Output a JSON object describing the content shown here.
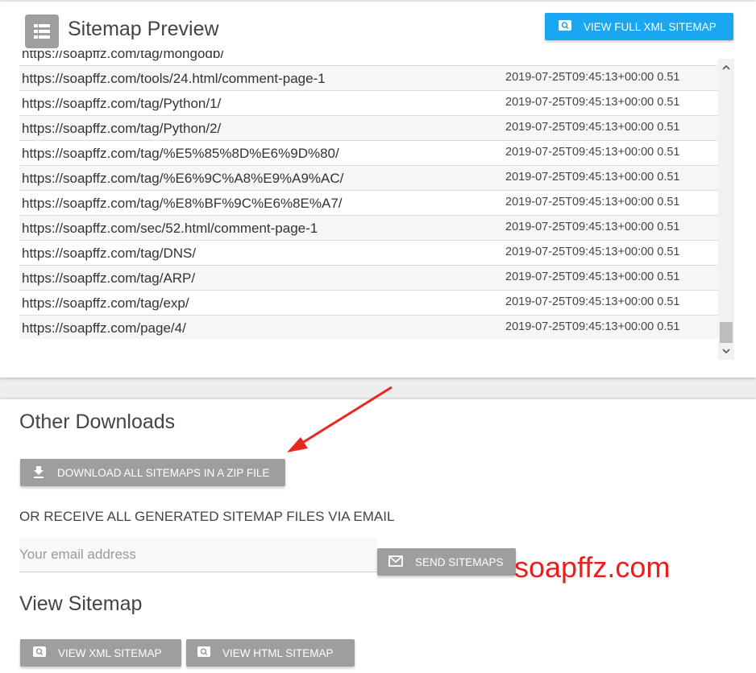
{
  "preview": {
    "title": "Sitemap Preview",
    "view_full_label": "VIEW FULL XML SITEMAP",
    "partial_row_url": "https://soapffz.com/tag/mongodb/",
    "rows": [
      {
        "url": "https://soapffz.com/tools/24.html/comment-page-1",
        "meta": "2019-07-25T09:45:13+00:00 0.51"
      },
      {
        "url": "https://soapffz.com/tag/Python/1/",
        "meta": "2019-07-25T09:45:13+00:00 0.51"
      },
      {
        "url": "https://soapffz.com/tag/Python/2/",
        "meta": "2019-07-25T09:45:13+00:00 0.51"
      },
      {
        "url": "https://soapffz.com/tag/%E5%85%8D%E6%9D%80/",
        "meta": "2019-07-25T09:45:13+00:00 0.51"
      },
      {
        "url": "https://soapffz.com/tag/%E6%9C%A8%E9%A9%AC/",
        "meta": "2019-07-25T09:45:13+00:00 0.51"
      },
      {
        "url": "https://soapffz.com/tag/%E8%BF%9C%E6%8E%A7/",
        "meta": "2019-07-25T09:45:13+00:00 0.51"
      },
      {
        "url": "https://soapffz.com/sec/52.html/comment-page-1",
        "meta": "2019-07-25T09:45:13+00:00 0.51"
      },
      {
        "url": "https://soapffz.com/tag/DNS/",
        "meta": "2019-07-25T09:45:13+00:00 0.51"
      },
      {
        "url": "https://soapffz.com/tag/ARP/",
        "meta": "2019-07-25T09:45:13+00:00 0.51"
      },
      {
        "url": "https://soapffz.com/tag/exp/",
        "meta": "2019-07-25T09:45:13+00:00 0.51"
      },
      {
        "url": "https://soapffz.com/page/4/",
        "meta": "2019-07-25T09:45:13+00:00 0.51"
      }
    ]
  },
  "downloads": {
    "title": "Other Downloads",
    "zip_label": "DOWNLOAD ALL SITEMAPS IN A ZIP FILE",
    "email_heading": "OR RECEIVE ALL GENERATED SITEMAP FILES VIA EMAIL",
    "email_placeholder": "Your email address",
    "send_label": "SEND SITEMAPS"
  },
  "view_sitemap": {
    "title": "View Sitemap",
    "xml_label": "VIEW XML SITEMAP",
    "html_label": "VIEW HTML SITEMAP"
  },
  "watermark": "soapffz.com",
  "icons": {
    "header": "list-icon",
    "search": "search-icon",
    "download": "download-icon",
    "mail": "mail-icon"
  },
  "colors": {
    "primary_blue": "#1aa6f0",
    "button_grey": "#9e9e9e",
    "watermark_red": "#ee1c1c",
    "annotation_red": "#e8271f"
  }
}
